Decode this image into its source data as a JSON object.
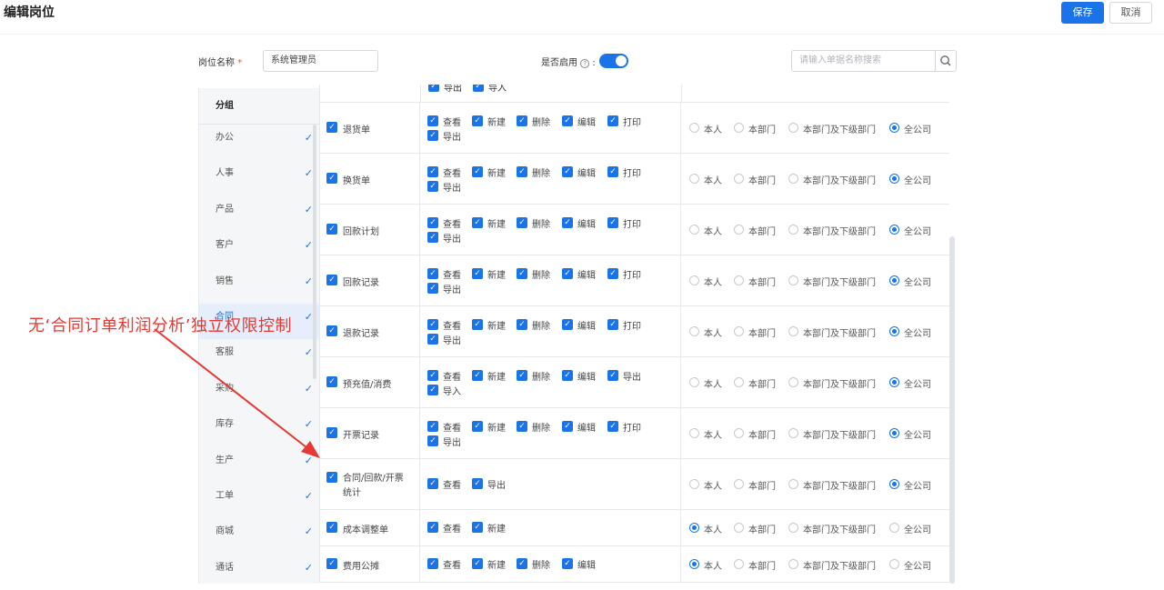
{
  "header": {
    "title": "编辑岗位",
    "save_label": "保存",
    "cancel_label": "取消"
  },
  "form": {
    "name_label": "岗位名称",
    "required_mark": "*",
    "name_value": "系统管理员",
    "enable_label": "是否启用",
    "help_glyph": "?",
    "enable_colon": ":",
    "enabled": true,
    "search_placeholder": "请输入单据名称搜索"
  },
  "sidebar": {
    "header": "分组",
    "items": [
      {
        "label": "办公"
      },
      {
        "label": "人事"
      },
      {
        "label": "产品"
      },
      {
        "label": "客户"
      },
      {
        "label": "销售"
      },
      {
        "label": "合同"
      },
      {
        "label": "客服"
      },
      {
        "label": "采购"
      },
      {
        "label": "库存"
      },
      {
        "label": "生产"
      },
      {
        "label": "工单"
      },
      {
        "label": "商城"
      },
      {
        "label": "通话"
      }
    ],
    "check_glyph": "✓"
  },
  "table": {
    "partial_perms": [
      "导出",
      "导入"
    ],
    "scope_options": [
      "本人",
      "本部门",
      "本部门及下级部门",
      "全公司"
    ],
    "rows": [
      {
        "name": [
          "退货单"
        ],
        "perms": [
          "查看",
          "新建",
          "删除",
          "编辑",
          "打印",
          "导出"
        ],
        "scope": "全公司"
      },
      {
        "name": [
          "换货单"
        ],
        "perms": [
          "查看",
          "新建",
          "删除",
          "编辑",
          "打印",
          "导出"
        ],
        "scope": "全公司"
      },
      {
        "name": [
          "回款计划"
        ],
        "perms": [
          "查看",
          "新建",
          "删除",
          "编辑",
          "打印",
          "导出"
        ],
        "scope": "全公司"
      },
      {
        "name": [
          "回款记录"
        ],
        "perms": [
          "查看",
          "新建",
          "删除",
          "编辑",
          "打印",
          "导出"
        ],
        "scope": "全公司"
      },
      {
        "name": [
          "退款记录"
        ],
        "perms": [
          "查看",
          "新建",
          "删除",
          "编辑",
          "打印",
          "导出"
        ],
        "scope": "全公司"
      },
      {
        "name": [
          "预充值/消费"
        ],
        "perms": [
          "查看",
          "新建",
          "删除",
          "编辑",
          "导出",
          "导入"
        ],
        "scope": "全公司"
      },
      {
        "name": [
          "开票记录"
        ],
        "perms": [
          "查看",
          "新建",
          "删除",
          "编辑",
          "打印",
          "导出"
        ],
        "scope": "全公司"
      },
      {
        "name": [
          "合同/回款/开票",
          "统计"
        ],
        "perms": [
          "查看",
          "导出"
        ],
        "scope": "全公司"
      },
      {
        "name": [
          "成本调整单"
        ],
        "perms": [
          "查看",
          "新建"
        ],
        "scope": "本人"
      },
      {
        "name": [
          "费用公摊"
        ],
        "perms": [
          "查看",
          "新建",
          "删除",
          "编辑"
        ],
        "scope": "本人"
      }
    ]
  },
  "annotation": {
    "text": "无‘合同订单利润分析’独立权限控制",
    "color": "#e53935"
  },
  "colors": {
    "accent": "#1a73e8"
  },
  "icons": {
    "search": "search-icon",
    "help": "help-icon",
    "check": "check-icon"
  }
}
